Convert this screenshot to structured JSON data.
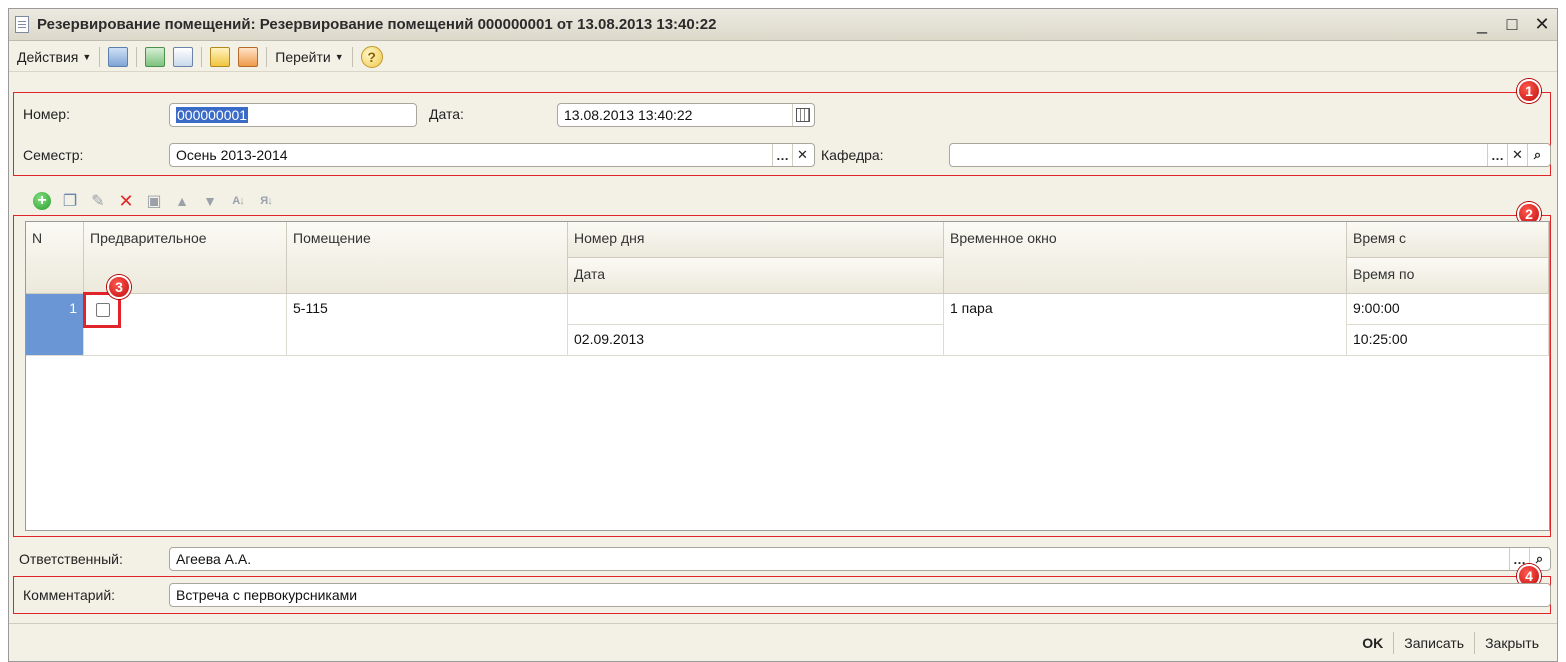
{
  "window": {
    "title": "Резервирование помещений: Резервирование помещений 000000001 от 13.08.2013 13:40:22",
    "controls": {
      "minimize": "_",
      "maximize": "□",
      "close": "✕"
    }
  },
  "toolbar": {
    "actions_label": "Действия",
    "goto_label": "Перейти",
    "help_label": "?"
  },
  "header": {
    "number_label": "Номер:",
    "number_value": "000000001",
    "date_label": "Дата:",
    "date_value": "13.08.2013 13:40:22",
    "semester_label": "Семестр:",
    "semester_value": "Осень 2013-2014",
    "department_label": "Кафедра:",
    "department_value": ""
  },
  "grid": {
    "columns": {
      "n": "N",
      "preliminary": "Предварительное",
      "room": "Помещение",
      "day_number": "Номер дня",
      "date": "Дата",
      "time_window": "Временное окно",
      "time_from": "Время с",
      "time_to": "Время по"
    },
    "rows": [
      {
        "n": "1",
        "preliminary": false,
        "room": "5-115",
        "day_number": "",
        "date": "02.09.2013",
        "time_window": "1 пара",
        "time_from": "9:00:00",
        "time_to": "10:25:00"
      }
    ]
  },
  "bottom": {
    "responsible_label": "Ответственный:",
    "responsible_value": "Агеева А.А.",
    "comment_label": "Комментарий:",
    "comment_value": "Встреча с первокурсниками"
  },
  "footer": {
    "ok_label": "OK",
    "save_label": "Записать",
    "close_label": "Закрыть"
  },
  "badges": [
    "1",
    "2",
    "3",
    "4"
  ],
  "colors": {
    "annotation": "#e0242a",
    "selection": "#3a6bc6"
  }
}
